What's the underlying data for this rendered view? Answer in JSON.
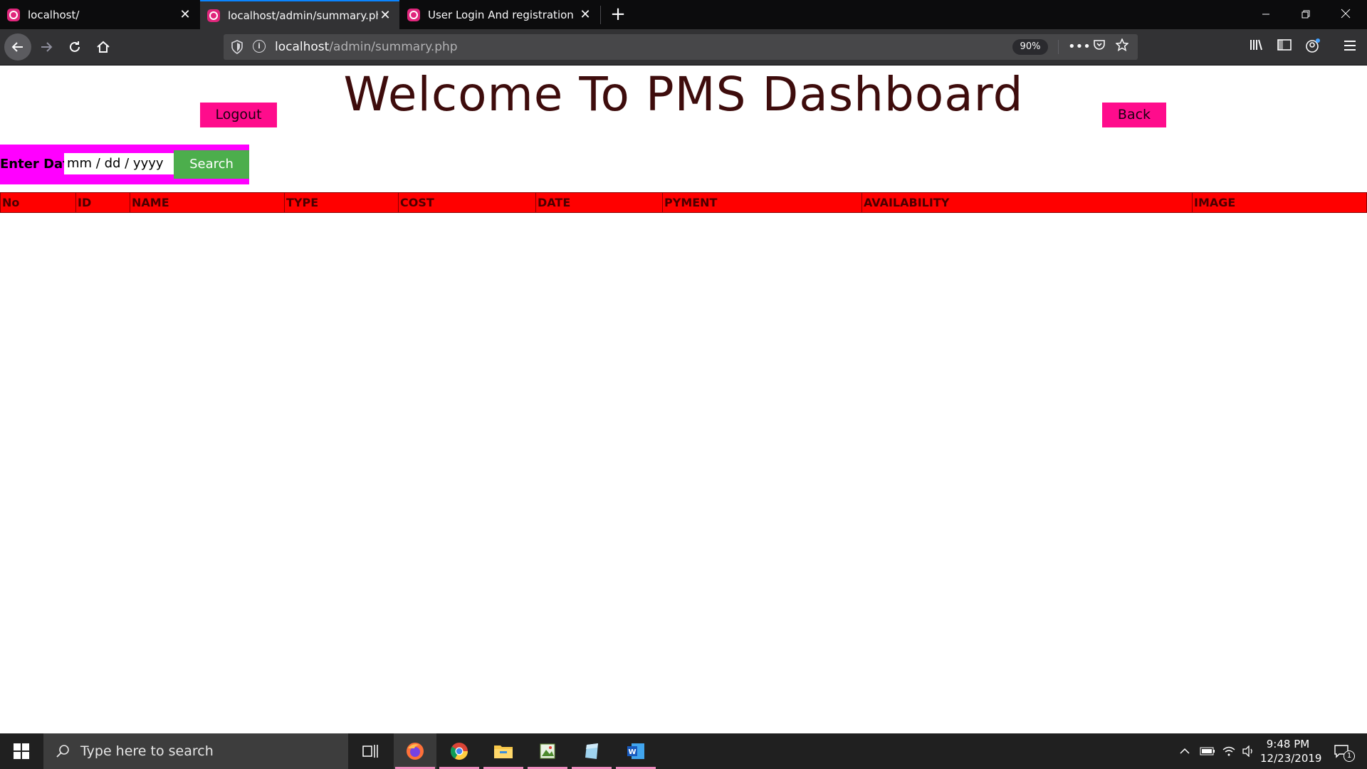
{
  "browser": {
    "tabs": [
      {
        "label": "localhost/",
        "active": false
      },
      {
        "label": "localhost/admin/summary.php",
        "active": true
      },
      {
        "label": "User Login And registration",
        "active": false
      }
    ],
    "url_host": "localhost",
    "url_path": "/admin/summary.php",
    "zoom": "90%",
    "accent_color": "#0a84ff"
  },
  "page": {
    "title": "Welcome To PMS Dashboard",
    "logout_label": "Logout",
    "back_label": "Back",
    "search": {
      "label": "Enter Date",
      "placeholder": "mm / dd / yyyy",
      "button_label": "Search"
    },
    "table": {
      "columns": [
        "No",
        "ID",
        "NAME",
        "TYPE",
        "COST",
        "DATE",
        "PYMENT",
        "AVAILABILITY",
        "IMAGE"
      ],
      "rows": []
    },
    "colors": {
      "title": "#3e0c0c",
      "button": "#ff0c8c",
      "search_panel": "#ff00ff",
      "search_button": "#4cae4c",
      "table_header": "#ff0000"
    }
  },
  "taskbar": {
    "search_placeholder": "Type here to search",
    "apps": [
      "firefox-icon",
      "chrome-icon",
      "file-explorer-icon",
      "image-viewer-icon",
      "notepad-icon",
      "word-icon"
    ],
    "time": "9:48 PM",
    "date": "12/23/2019",
    "notification_count": "1"
  }
}
